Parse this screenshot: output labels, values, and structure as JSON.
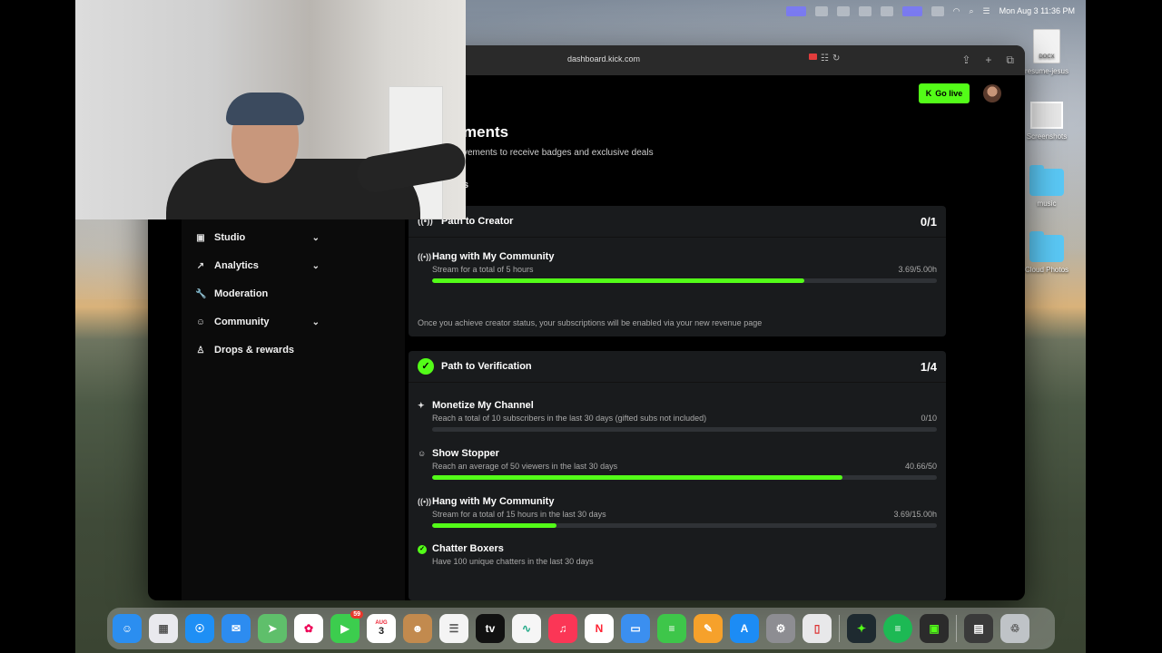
{
  "menubar": {
    "clock": "Mon Aug 3  11:36 PM"
  },
  "desktop": {
    "items": [
      {
        "label": "resume-jesus",
        "badge": "DOCX"
      },
      {
        "label": "Screenshots"
      },
      {
        "label": "music"
      },
      {
        "label": "Cloud Photos"
      }
    ]
  },
  "browser": {
    "url": "dashboard.kick.com"
  },
  "header": {
    "go_live": "Go live"
  },
  "page": {
    "title": "ments",
    "subtitle": "vements to receive badges and exclusive deals",
    "section": "s"
  },
  "sidebar": {
    "items": [
      {
        "label": "Studio",
        "icon": "studio-icon",
        "expandable": true
      },
      {
        "label": "Analytics",
        "icon": "analytics-icon",
        "expandable": true
      },
      {
        "label": "Moderation",
        "icon": "wrench-icon",
        "expandable": false
      },
      {
        "label": "Community",
        "icon": "community-icon",
        "expandable": true
      },
      {
        "label": "Drops & rewards",
        "icon": "drops-icon",
        "expandable": false
      }
    ]
  },
  "creator": {
    "title": "Path to Creator",
    "score": "0/1",
    "items": [
      {
        "title": "Hang with My Community",
        "desc": "Stream for a total of 5 hours",
        "progress_text": "3.69/5.00h",
        "progress": 0.738
      }
    ],
    "footer": "Once you achieve creator status, your subscriptions will be enabled via your new revenue page"
  },
  "verification": {
    "title": "Path to Verification",
    "score": "1/4",
    "items": [
      {
        "title": "Monetize My Channel",
        "desc": "Reach a total of 10 subscribers in the last 30 days (gifted subs not included)",
        "progress_text": "0/10",
        "progress": 0.0
      },
      {
        "title": "Show Stopper",
        "desc": "Reach an average of 50 viewers in the last 30 days",
        "progress_text": "40.66/50",
        "progress": 0.813
      },
      {
        "title": "Hang with My Community",
        "desc": "Stream for a total of 15 hours in the last 30 days",
        "progress_text": "3.69/15.00h",
        "progress": 0.246
      },
      {
        "title": "Chatter Boxers",
        "desc": "Have 100 unique chatters in the last 30 days",
        "completed": true
      }
    ]
  },
  "dock": {
    "badges": {
      "facetime": "59"
    },
    "calendar": {
      "month": "AUG",
      "day": "3"
    }
  },
  "colors": {
    "accent": "#53fc18",
    "card": "#191b1d",
    "background": "#000000"
  }
}
